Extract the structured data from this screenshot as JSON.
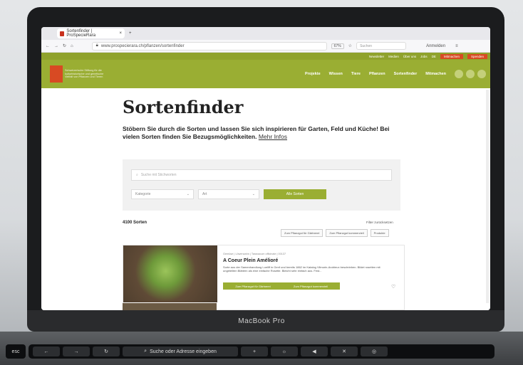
{
  "device": {
    "label": "MacBook Pro"
  },
  "browser": {
    "tab_title": "Sortenfinder | ProSpecieRara",
    "url": "www.prospecierara.ch/pflanzen/sortenfinder",
    "zoom": "67%",
    "search_placeholder": "Suchen",
    "account_label": "Anmelden"
  },
  "site": {
    "top_links": [
      "Newsletter",
      "Medien",
      "Über uns",
      "Jobs",
      "DE"
    ],
    "top_cta": "Mitmachen",
    "top_cta_2": "Spenden",
    "logo_text": "Schweizerische Stiftung für die kulturhistorische und genetische Vielfalt von Pflanzen und Tieren",
    "menu": [
      "Projekte",
      "Wissen",
      "Tiere",
      "Pflanzen",
      "Sortenfinder",
      "Mitmachen"
    ]
  },
  "page": {
    "title": "Sortenfinder",
    "intro": "Stöbern Sie durch die Sorten und lassen Sie sich inspirieren für Garten, Feld und Küche! Bei vielen Sorten finden Sie Bezugsmöglichkeiten.",
    "more_link": "Mehr Infos",
    "search_placeholder": "Suche mit Stichworten",
    "select_1": "Kategorie",
    "select_2": "Art",
    "submit": "Alle Sorten",
    "count": "4100 Sorten",
    "reset": "Filter zurücksetzen",
    "filter_chips": [
      "Zum Pflanzgut für Gärtnerei",
      "Zum Pflanzgut kommerziell",
      "Produkte"
    ]
  },
  "card": {
    "meta": "Gemüse | Löwenzahn | Taraxacum officinale | 00137",
    "title": "A Coeur Plein Amélioré",
    "desc": "Sorte aus der Samenhandlung Loeliff in Genf und bereits 1862 im Katalog Vilmorin-Andrieux beschrieben. Bildet rosetten mit ungeteilten Blättern als eine einfache Rosette. Bleicht sehr einfach aus. Fest...",
    "btn1": "Zum Pflanzgut für Gärtnerei",
    "btn2": "Zum Pflanzgut kommerziell"
  },
  "touchbar": {
    "search": "Suche oder Adresse eingeben",
    "esc": "esc"
  }
}
